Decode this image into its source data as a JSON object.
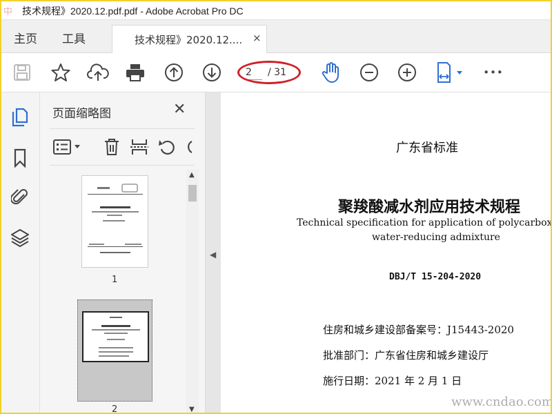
{
  "window": {
    "title": "技术规程》2020.12.pdf.pdf - Adobe Acrobat Pro DC",
    "logo_text": "中"
  },
  "tabs": {
    "home": "主页",
    "tools": "工具",
    "document": "技术规程》2020.12....",
    "close": "×"
  },
  "toolbar": {
    "current_page": "2",
    "total_pages": "/ 31",
    "more": "•••"
  },
  "panel": {
    "title": "页面缩略图",
    "close": "✕",
    "thumbnails": [
      {
        "label": "1"
      },
      {
        "label": "2"
      }
    ]
  },
  "document": {
    "std_org": "广东省标准",
    "title_cn": "聚羧酸减水剂应用技术规程",
    "title_en_1": "Technical specification for application of polycarboxyl",
    "title_en_2": "water-reducing admixture",
    "code": "DBJ/T 15-204-2020",
    "record": "住房和城乡建设部备案号：J15443-2020",
    "approver": "批准部门：广东省住房和城乡建设厅",
    "effective": "施行日期：2021 年 2 月 1 日"
  },
  "watermark": "www.cndao.com",
  "colors": {
    "accent": "#2f6fd0",
    "highlight_ring": "#d0202a",
    "frame": "#f2d02a"
  }
}
